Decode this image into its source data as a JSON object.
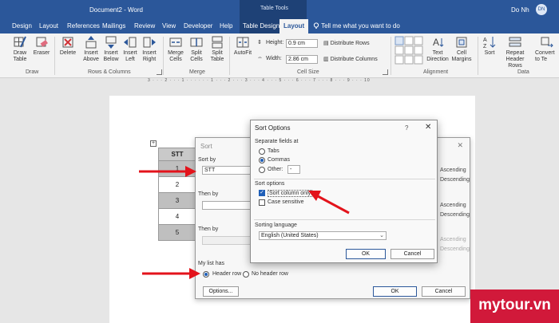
{
  "titlebar": {
    "document_title": "Document2 - Word",
    "context_label": "Table Tools",
    "user_name": "Do Nh",
    "user_initials": "DN"
  },
  "tabs": [
    "Design",
    "Layout",
    "References",
    "Mailings",
    "Review",
    "View",
    "Developer",
    "Help",
    "Table Design",
    "Layout"
  ],
  "tell_me": "Tell me what you want to do",
  "ribbon": {
    "draw": {
      "draw_table": "Draw Table",
      "eraser": "Eraser",
      "group": "Draw"
    },
    "rows_columns": {
      "delete": "Delete",
      "insert_above": "Insert Above",
      "insert_below": "Insert Below",
      "insert_left": "Insert Left",
      "insert_right": "Insert Right",
      "group": "Rows & Columns"
    },
    "merge": {
      "merge_cells": "Merge Cells",
      "split_cells": "Split Cells",
      "split_table": "Split Table",
      "group": "Merge"
    },
    "cell_size": {
      "autofit": "AutoFit",
      "height_label": "Height:",
      "height_value": "0.9 cm",
      "width_label": "Width:",
      "width_value": "2.86 cm",
      "distribute_rows": "Distribute Rows",
      "distribute_columns": "Distribute Columns",
      "group": "Cell Size"
    },
    "alignment": {
      "text_direction": "Text Direction",
      "cell_margins": "Cell Margins",
      "group": "Alignment"
    },
    "data": {
      "sort": "Sort",
      "repeat_header": "Repeat Header Rows",
      "convert": "Convert to Te",
      "group": "Data"
    }
  },
  "ruler": "3 · · · 2 · · · 1 · · · · · · 1 · · · 2 · · · 3 · · · 4 · · · 5 · · · 6 · · · 7 · · · 8 · · · 9 · · · 10",
  "doc_table": {
    "header": "STT",
    "rows": [
      "1",
      "2",
      "3",
      "4",
      "5"
    ]
  },
  "sort_dialog": {
    "title": "Sort",
    "sort_by_label": "Sort by",
    "sort_by_value": "STT",
    "then_by_label": "Then by",
    "then_by2_label": "Then by",
    "ascending": "Ascending",
    "descending": "Descending",
    "my_list_has": "My list has",
    "header_row": "Header row",
    "no_header_row": "No header row",
    "options_button": "Options...",
    "ok": "OK",
    "cancel": "Cancel"
  },
  "options_dialog": {
    "title": "Sort Options",
    "help": "?",
    "separate_fields_label": "Separate fields at",
    "tabs": "Tabs",
    "commas": "Commas",
    "other": "Other:",
    "other_value": "-",
    "sort_options_label": "Sort options",
    "sort_column_only": "Sort column only",
    "case_sensitive": "Case sensitive",
    "sorting_language_label": "Sorting language",
    "sorting_language_value": "English (United States)",
    "ok": "OK",
    "cancel": "Cancel"
  },
  "watermark": "mytour.vn",
  "colors": {
    "accent": "#2b579a",
    "arrow": "#e3131b",
    "watermark": "#d1193a",
    "checked": "#1f5fb8"
  }
}
